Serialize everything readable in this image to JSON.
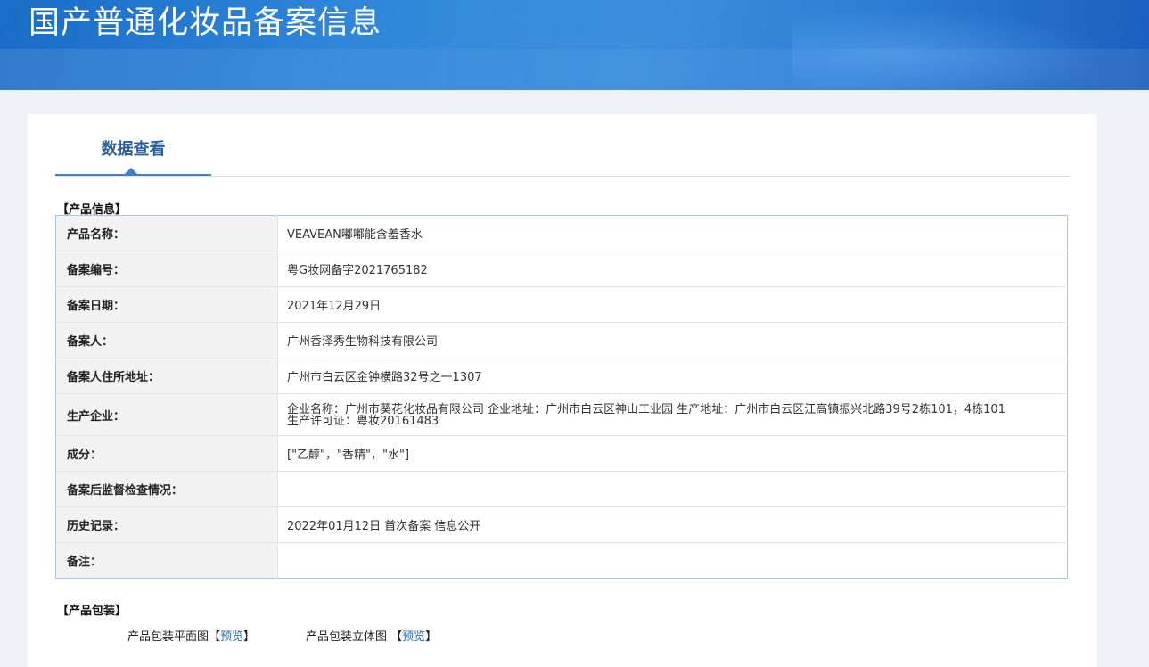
{
  "header": {
    "title": "国产普通化妆品备案信息"
  },
  "tab": {
    "label": "数据查看"
  },
  "product_section": {
    "title": "【产品信息】",
    "rows": [
      {
        "label": "产品名称：",
        "value": "VEAVEAN嘟嘟能含羞香水"
      },
      {
        "label": "备案编号：",
        "value": "粤G妆网备字2021765182"
      },
      {
        "label": "备案日期：",
        "value": "2021年12月29日"
      },
      {
        "label": "备案人：",
        "value": "广州香泽秀生物科技有限公司"
      },
      {
        "label": "备案人住所地址：",
        "value": "广州市白云区金钟横路32号之一1307"
      },
      {
        "label": "生产企业：",
        "value": "企业名称：广州市葵花化妆品有限公司 企业地址：广州市白云区神山工业园 生产地址：广州市白云区江高镇振兴北路39号2栋101，4栋101",
        "value2": "生产许可证：粤妆20161483"
      },
      {
        "label": "成分：",
        "value": "[\"乙醇\"，\"香精\"，\"水\"]"
      },
      {
        "label": "备案后监督检查情况：",
        "value": ""
      },
      {
        "label": "历史记录：",
        "value": "2022年01月12日 首次备案 信息公开"
      },
      {
        "label": "备注：",
        "value": ""
      }
    ]
  },
  "package_section": {
    "title": "【产品包装】",
    "flat_label": "产品包装平面图",
    "flat_link_open": "【",
    "flat_link": "预览",
    "flat_link_close": "】",
    "solid_label": "产品包装立体图",
    "solid_link_open": " 【",
    "solid_link": "预览",
    "solid_link_close": "】"
  }
}
